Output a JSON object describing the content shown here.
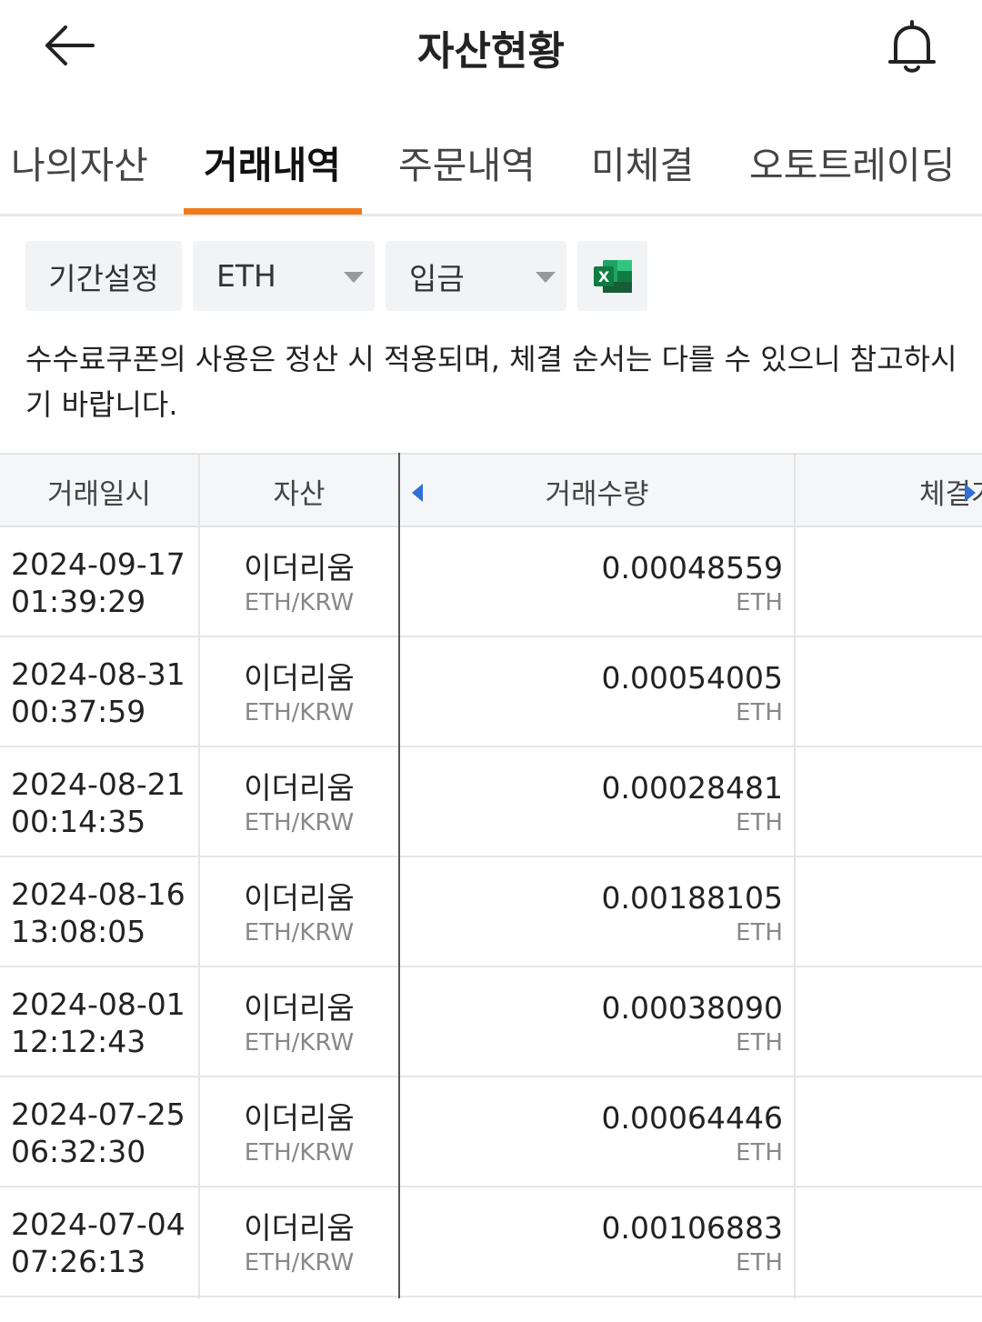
{
  "header": {
    "title": "자산현황",
    "back_icon": "arrow-left-icon",
    "bell_icon": "bell-icon"
  },
  "tabs": [
    {
      "label": "나의자산",
      "active": false
    },
    {
      "label": "거래내역",
      "active": true
    },
    {
      "label": "주문내역",
      "active": false
    },
    {
      "label": "미체결",
      "active": false
    },
    {
      "label": "오토트레이딩",
      "active": false
    }
  ],
  "filters": {
    "period_label": "기간설정",
    "asset_selected": "ETH",
    "type_selected": "입금",
    "excel_icon": "excel-icon"
  },
  "notice": "수수료쿠폰의 사용은 정산 시 적용되며, 체결 순서는 다를 수 있으니 참고하시기 바랍니다.",
  "table": {
    "headers": {
      "date": "거래일시",
      "asset": "자산",
      "qty": "거래수량",
      "price": "체결가"
    },
    "rows": [
      {
        "date": "2024-09-17",
        "time": "01:39:29",
        "asset": "이더리움",
        "pair": "ETH/KRW",
        "qty": "0.00048559",
        "unit": "ETH"
      },
      {
        "date": "2024-08-31",
        "time": "00:37:59",
        "asset": "이더리움",
        "pair": "ETH/KRW",
        "qty": "0.00054005",
        "unit": "ETH"
      },
      {
        "date": "2024-08-21",
        "time": "00:14:35",
        "asset": "이더리움",
        "pair": "ETH/KRW",
        "qty": "0.00028481",
        "unit": "ETH"
      },
      {
        "date": "2024-08-16",
        "time": "13:08:05",
        "asset": "이더리움",
        "pair": "ETH/KRW",
        "qty": "0.00188105",
        "unit": "ETH"
      },
      {
        "date": "2024-08-01",
        "time": "12:12:43",
        "asset": "이더리움",
        "pair": "ETH/KRW",
        "qty": "0.00038090",
        "unit": "ETH"
      },
      {
        "date": "2024-07-25",
        "time": "06:32:30",
        "asset": "이더리움",
        "pair": "ETH/KRW",
        "qty": "0.00064446",
        "unit": "ETH"
      },
      {
        "date": "2024-07-04",
        "time": "07:26:13",
        "asset": "이더리움",
        "pair": "ETH/KRW",
        "qty": "0.00106883",
        "unit": "ETH"
      }
    ]
  },
  "colors": {
    "accent": "#f07a1a",
    "scroll_arrow": "#2f6fd6",
    "excel_green": "#1f7a45"
  }
}
